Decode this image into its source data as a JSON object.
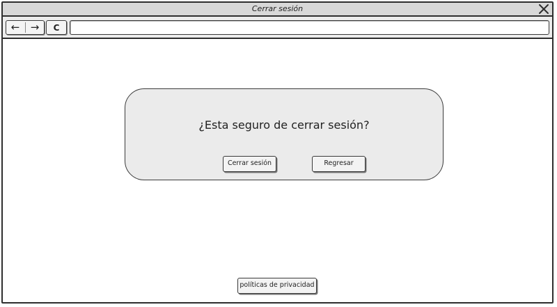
{
  "window": {
    "title": "Cerrar sesión"
  },
  "toolbar": {
    "back_icon": "arrow-left-icon",
    "forward_icon": "arrow-right-icon",
    "reload_icon": "reload-icon",
    "back_glyph": "←",
    "forward_glyph": "→",
    "reload_glyph": "C",
    "address_value": ""
  },
  "dialog": {
    "question": "¿Esta seguro de cerrar sesión?",
    "logout_label": "Cerrar sesión",
    "back_label": "Regresar"
  },
  "footer": {
    "privacy_label": "políticas de privacidad"
  }
}
